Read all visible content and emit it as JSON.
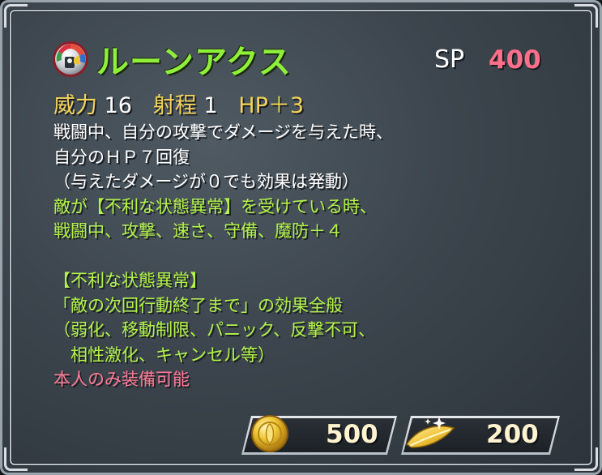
{
  "skill": {
    "icon": "rune-axe-icon",
    "name": "ルーンアクス",
    "sp_label": "SP",
    "sp_value": "400"
  },
  "stats": {
    "might_label": "威力",
    "might_value": "16",
    "range_label": "射程",
    "range_value": "1",
    "hp_label": "HP＋3"
  },
  "description": [
    {
      "text": "戦闘中、自分の攻撃でダメージを与えた時、",
      "color": "white"
    },
    {
      "text": "自分のＨＰ７回復",
      "color": "white"
    },
    {
      "text": "（与えたダメージが０でも効果は発動）",
      "color": "white"
    },
    {
      "text": "敵が【不利な状態異常】を受けている時、",
      "color": "green"
    },
    {
      "text": "戦闘中、攻撃、速さ、守備、魔防＋４",
      "color": "green"
    },
    {
      "text": "",
      "color": "green"
    },
    {
      "text": "【不利な状態異常】",
      "color": "green"
    },
    {
      "text": "「敵の次回行動終了まで」の効果全般",
      "color": "green"
    },
    {
      "text": "（弱化、移動制限、パニック、反撃不可、",
      "color": "green"
    },
    {
      "text": "　相性激化、キャンセル等）",
      "color": "green"
    },
    {
      "text": "本人のみ装備可能",
      "color": "pink"
    }
  ],
  "costs": {
    "coin_icon": "gold-coin-icon",
    "coin_value": "500",
    "feather_icon": "hero-feather-icon",
    "feather_value": "200"
  },
  "colors": {
    "title_green": "#8ff03a",
    "effect_green": "#b2f24a",
    "sp_pink": "#ff6f8a",
    "label_gold": "#f4d35a",
    "restriction_pink": "#ff7a97"
  }
}
